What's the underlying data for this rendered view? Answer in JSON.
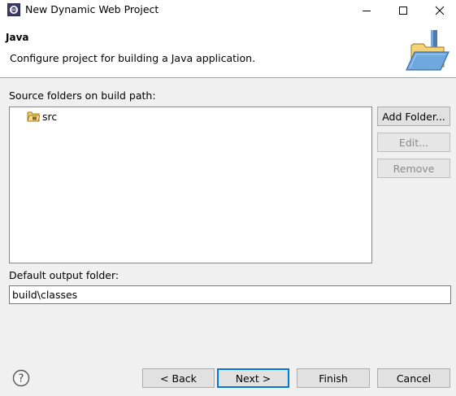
{
  "window": {
    "title": "New Dynamic Web Project"
  },
  "header": {
    "title": "Java",
    "description": "Configure project for building a Java application."
  },
  "source": {
    "label": "Source folders on build path:",
    "items": [
      {
        "label": "src",
        "icon": "source-folder-icon"
      }
    ]
  },
  "side_buttons": {
    "add_folder": "Add Folder...",
    "edit": "Edit...",
    "remove": "Remove"
  },
  "output": {
    "label": "Default output folder:",
    "value": "build\\classes"
  },
  "footer": {
    "back": "< Back",
    "next": "Next >",
    "finish": "Finish",
    "cancel": "Cancel"
  },
  "colors": {
    "accent": "#0078d7",
    "folder": "#e8b84a"
  }
}
